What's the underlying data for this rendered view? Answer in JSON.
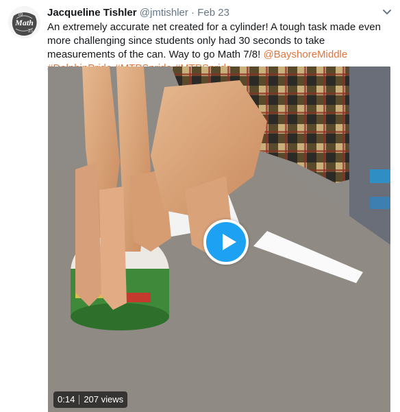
{
  "tweet": {
    "author_name": "Jacqueline Tishler",
    "handle": "@jmtishler",
    "separator": "·",
    "date": "Feb 23",
    "text_plain": "An extremely accurate net created for a cylinder! A tough task made even more challenging since students only had 30 seconds to take measurements of the can. Way to go Math 7/8! ",
    "hashtags": [
      "@BayshoreMiddle",
      "#DolphinPride",
      "#MTPSpride",
      "#MTPSpride"
    ]
  },
  "avatar": {
    "text_top": "10",
    "text_main": "Math",
    "text_bottom": "25"
  },
  "video": {
    "duration": "0:14",
    "views": "207 views"
  },
  "colors": {
    "link": "#e0763c",
    "play_button": "#1da1f2",
    "text_secondary": "#657786"
  }
}
